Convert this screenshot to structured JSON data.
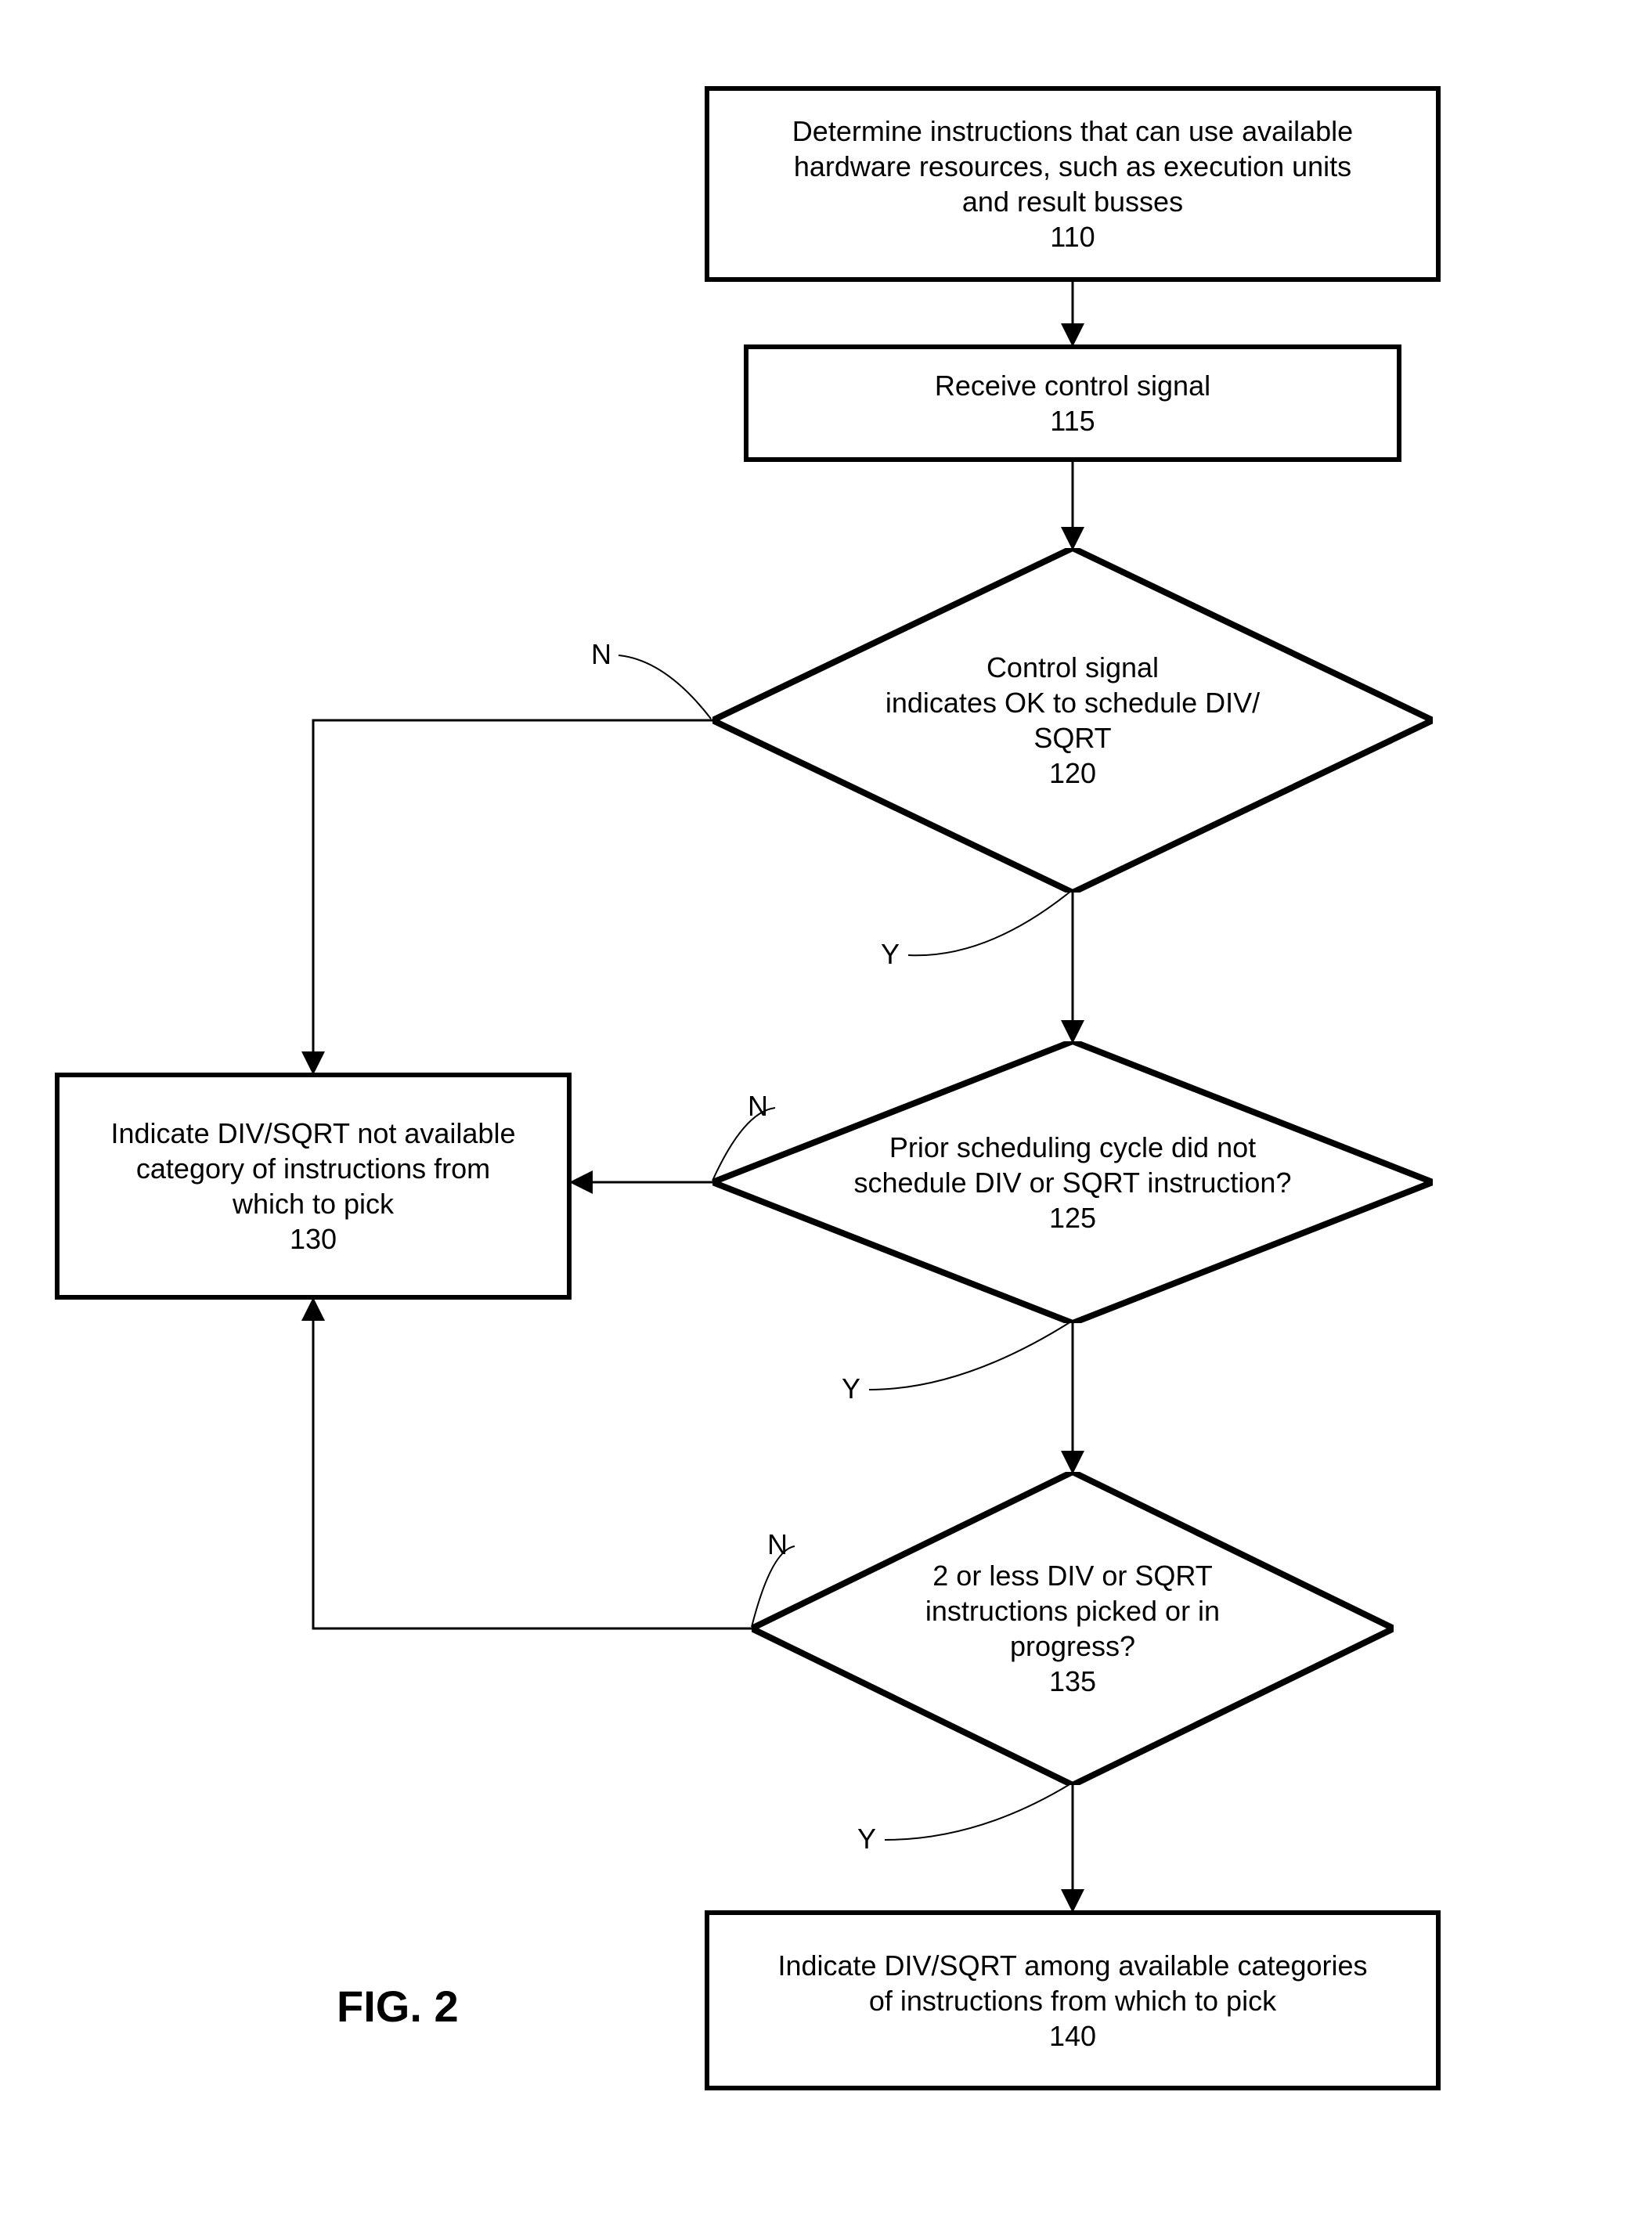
{
  "figure_label": "FIG. 2",
  "nodes": {
    "n110": {
      "lines": [
        "Determine instructions that can use available",
        "hardware resources, such as execution units",
        "and result busses"
      ],
      "ref": "110"
    },
    "n115": {
      "lines": [
        "Receive control signal"
      ],
      "ref": "115"
    },
    "n120": {
      "lines": [
        "Control signal",
        "indicates OK to schedule DIV/",
        "SQRT"
      ],
      "ref": "120"
    },
    "n125": {
      "lines": [
        "Prior scheduling cycle did not",
        "schedule DIV or SQRT instruction?"
      ],
      "ref": "125"
    },
    "n130": {
      "lines": [
        "Indicate DIV/SQRT not available",
        "category of instructions from",
        "which to pick"
      ],
      "ref": "130"
    },
    "n135": {
      "lines": [
        "2 or less DIV or SQRT",
        "instructions picked or in",
        "progress?"
      ],
      "ref": "135"
    },
    "n140": {
      "lines": [
        "Indicate DIV/SQRT among available categories",
        "of instructions from which to pick"
      ],
      "ref": "140"
    }
  },
  "edge_labels": {
    "n120_no": "N",
    "n120_yes": "Y",
    "n125_no": "N",
    "n125_yes": "Y",
    "n135_no": "N",
    "n135_yes": "Y"
  },
  "chart_data": {
    "type": "flowchart",
    "nodes": [
      {
        "id": "110",
        "shape": "process",
        "text": "Determine instructions that can use available hardware resources, such as execution units and result busses"
      },
      {
        "id": "115",
        "shape": "process",
        "text": "Receive control signal"
      },
      {
        "id": "120",
        "shape": "decision",
        "text": "Control signal indicates OK to schedule DIV/SQRT"
      },
      {
        "id": "125",
        "shape": "decision",
        "text": "Prior scheduling cycle did not schedule DIV or SQRT instruction?"
      },
      {
        "id": "130",
        "shape": "process",
        "text": "Indicate DIV/SQRT not available category of instructions from which to pick"
      },
      {
        "id": "135",
        "shape": "decision",
        "text": "2 or less DIV or SQRT instructions picked or in progress?"
      },
      {
        "id": "140",
        "shape": "process",
        "text": "Indicate DIV/SQRT among available categories of instructions from which to pick"
      }
    ],
    "edges": [
      {
        "from": "110",
        "to": "115",
        "label": ""
      },
      {
        "from": "115",
        "to": "120",
        "label": ""
      },
      {
        "from": "120",
        "to": "130",
        "label": "N"
      },
      {
        "from": "120",
        "to": "125",
        "label": "Y"
      },
      {
        "from": "125",
        "to": "130",
        "label": "N"
      },
      {
        "from": "125",
        "to": "135",
        "label": "Y"
      },
      {
        "from": "135",
        "to": "130",
        "label": "N"
      },
      {
        "from": "135",
        "to": "140",
        "label": "Y"
      }
    ]
  }
}
